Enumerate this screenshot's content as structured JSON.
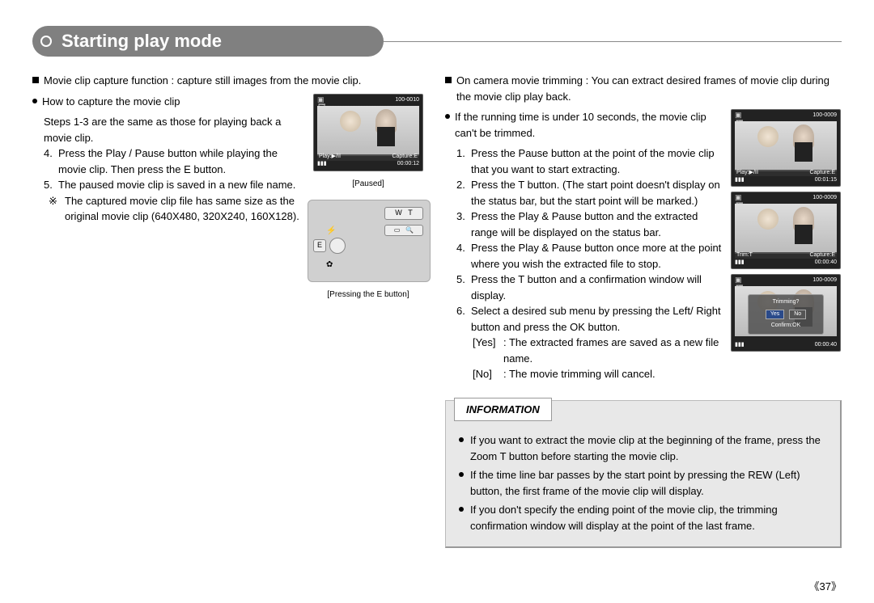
{
  "title": "Starting play mode",
  "page_number": "《37》",
  "left": {
    "intro": "Movie clip capture function : capture still images from the movie clip.",
    "howto": "How to capture the movie clip",
    "pre": "Steps 1-3 are the same as those for playing back a movie clip.",
    "s4": "Press the Play / Pause button while playing the movie clip. Then press the E button.",
    "s5": "The paused movie clip is saved in a new file name.",
    "note_mark": "※",
    "note": "The captured movie clip file has same size as the original movie clip (640X480, 320X240, 160X128).",
    "cap1": "[Paused]",
    "cap2": "[Pressing the E button]",
    "lcd1": {
      "file": "100-0010",
      "left": "Play:▶/ⅠⅠ",
      "right": "Capture:E",
      "time": "00:00:12"
    }
  },
  "right": {
    "intro": "On camera movie trimming : You can extract desired frames of movie clip during the movie clip play back.",
    "cond": "If the running time is under 10 seconds, the movie clip can't be trimmed.",
    "s1": "Press the Pause button at the point of the movie clip that you want to start extracting.",
    "s2": "Press the T button. (The start point doesn't display on the status bar, but the start point will be marked.)",
    "s3": "Press the Play & Pause button and the extracted range will be displayed on the status bar.",
    "s4": "Press the Play & Pause button once more at the point where you wish the extracted file to stop.",
    "s5": "Press the T button and a confirmation window will display.",
    "s6": "Select a desired sub menu by pressing the Left/ Right button and press the OK button.",
    "yes_l": "[Yes]",
    "yes": ": The extracted frames are saved as a new file name.",
    "no_l": "[No]",
    "no": ": The movie trimming will cancel.",
    "lcdA": {
      "file": "100-0009",
      "left": "Play:▶/ⅠⅠ",
      "right": "Capture:E",
      "time": "00:01:15"
    },
    "lcdB": {
      "file": "100-0009",
      "left": "Trim:T",
      "right": "Capture:E",
      "time": "00:00:40"
    },
    "lcdC": {
      "file": "100-0009",
      "time": "00:00:40",
      "dlg_title": "Trimming?",
      "dlg_yes": "Yes",
      "dlg_no": "No",
      "dlg_confirm": "Confirm:OK"
    }
  },
  "info": {
    "title": "INFORMATION",
    "i1": "If you want to extract the movie clip at the beginning of the frame, press the Zoom T button before starting the movie clip.",
    "i2": "If the time line bar passes by the start point by pressing the REW (Left) button, the first frame of the movie clip will display.",
    "i3": "If you don't specify the ending point of the movie clip, the trimming confirmation window will display at the point of the last frame."
  },
  "cam": {
    "w": "W",
    "t": "T",
    "e": "E",
    "mag": "🔍"
  }
}
